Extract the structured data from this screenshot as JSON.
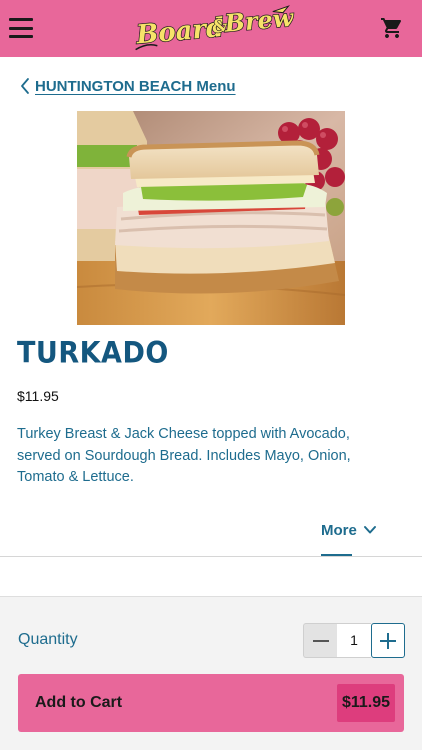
{
  "header": {
    "logo_text": "Board & Brew",
    "menu_icon": "hamburger-menu-icon",
    "cart_icon": "shopping-cart-icon",
    "brand_color": "#e8679a"
  },
  "nav": {
    "back_label": "HUNTINGTON BEACH Menu",
    "back_icon": "chevron-left-icon"
  },
  "product": {
    "image_subject": "sandwich-photo",
    "name": "TURKADO",
    "price": "$11.95",
    "description": "Turkey Breast & Jack Cheese topped with Avocado, served on Sourdough Bread. Includes Mayo, Onion, Tomato & Lettuce."
  },
  "tabs": {
    "more_label": "More",
    "more_icon": "chevron-down-icon"
  },
  "order": {
    "quantity_label": "Quantity",
    "quantity_value": "1",
    "add_to_cart_label": "Add to Cart",
    "total": "$11.95"
  },
  "colors": {
    "accent": "#e8679a",
    "accent_dark": "#dd3d7d",
    "text_blue": "#1e6c8e",
    "title_blue": "#14577f"
  }
}
